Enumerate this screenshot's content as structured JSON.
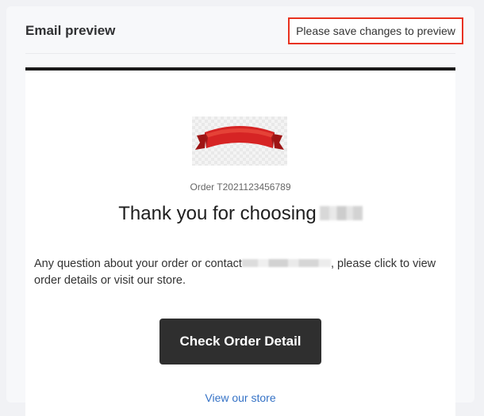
{
  "panel": {
    "title": "Email preview",
    "save_hint": "Please save changes to preview"
  },
  "email": {
    "logo_icon": "red-ribbon-banner",
    "order_number": "Order T2021123456789",
    "thanks_heading": "Thank you for choosing",
    "body_text_before": "Any question about your order or contact",
    "body_text_after": ", please click to view order details or visit our store.",
    "cta_label": "Check Order Detail",
    "store_link": "View our store"
  },
  "colors": {
    "accent_border": "#e8321e",
    "cta_background": "#2f2f2f",
    "link": "#3572c6"
  }
}
